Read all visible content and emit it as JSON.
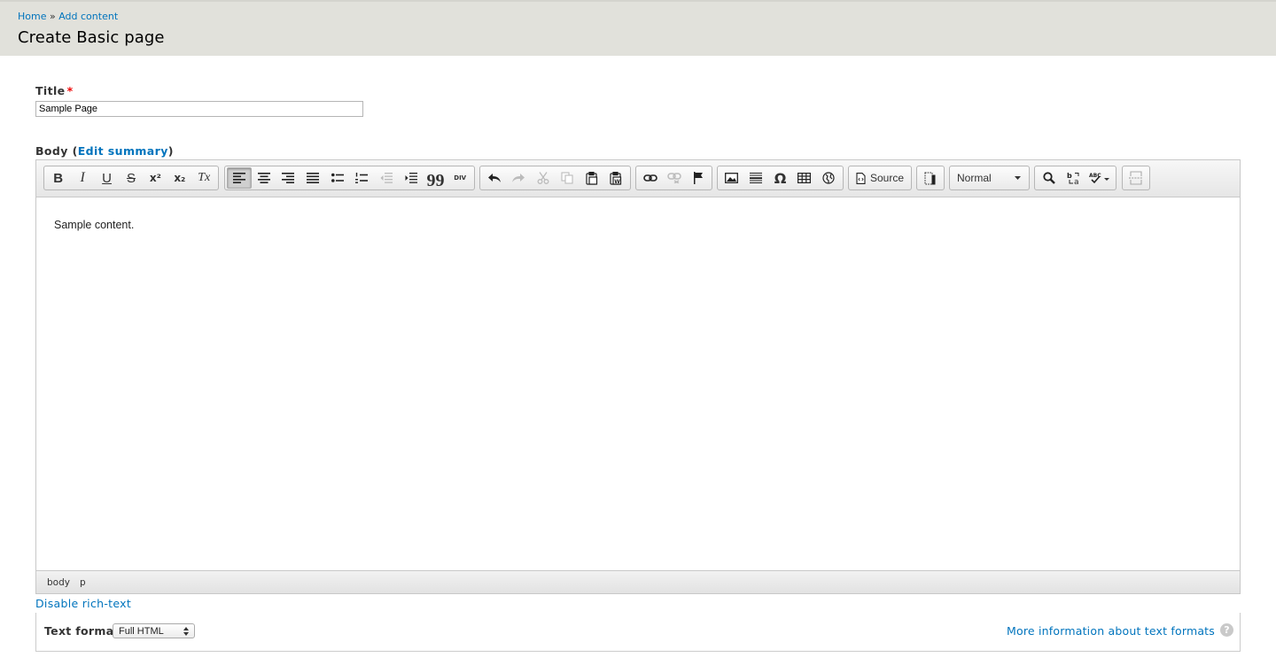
{
  "header": {
    "breadcrumb": {
      "home": "Home",
      "separator": "»",
      "add_content": "Add content"
    },
    "title": "Create Basic page"
  },
  "form": {
    "title_label": "Title",
    "required_mark": "*",
    "title_value": "Sample Page",
    "body_label": "Body",
    "body_paren_open": "(",
    "edit_summary": "Edit summary",
    "body_paren_close": ")"
  },
  "editor": {
    "toolbar": {
      "bold": "B",
      "italic": "I",
      "underline": "U",
      "strike": "S",
      "superscript": "x²",
      "subscript": "x₂",
      "remove_format": "Tx",
      "blockquote": "99",
      "div": "DIV",
      "special_char": "Ω",
      "source_label": "Source",
      "format_value": "Normal"
    },
    "content_text": "Sample content.",
    "path": {
      "body": "body",
      "p": "p"
    }
  },
  "disable_rich_text": "Disable rich-text",
  "text_format": {
    "label": "Text format",
    "selected": "Full HTML",
    "more_info": "More information about text formats",
    "help": "?"
  },
  "colors": {
    "link": "#0074bd",
    "header_bg": "#e1e1db",
    "required": "#e00000"
  }
}
